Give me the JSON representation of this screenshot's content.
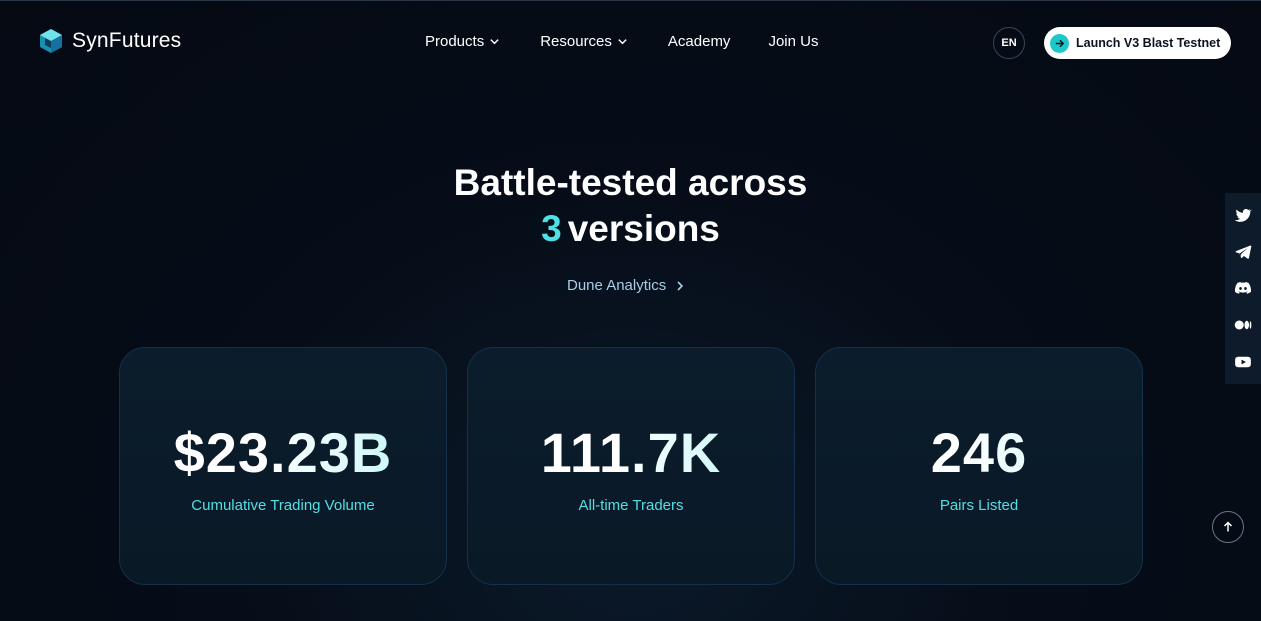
{
  "header": {
    "brand": "SynFutures",
    "nav": [
      {
        "label": "Products",
        "has_dropdown": true
      },
      {
        "label": "Resources",
        "has_dropdown": true
      },
      {
        "label": "Academy",
        "has_dropdown": false
      },
      {
        "label": "Join Us",
        "has_dropdown": false
      }
    ],
    "language": "EN",
    "launch_button": "Launch V3 Blast Testnet"
  },
  "hero": {
    "title_line1": "Battle-tested across",
    "accent_number": "3",
    "title_line2_rest": "versions",
    "link_label": "Dune Analytics"
  },
  "stats": [
    {
      "value": "$23.23B",
      "label": "Cumulative Trading Volume"
    },
    {
      "value": "111.7K",
      "label": "All-time Traders"
    },
    {
      "value": "246",
      "label": "Pairs Listed"
    }
  ],
  "social_icons": [
    "twitter-icon",
    "telegram-icon",
    "discord-icon",
    "medium-icon",
    "youtube-icon"
  ],
  "colors": {
    "background": "#050b15",
    "accent": "#4ee0e6",
    "card_border": "#14304a",
    "launch_icon": "#1fc8c8"
  }
}
